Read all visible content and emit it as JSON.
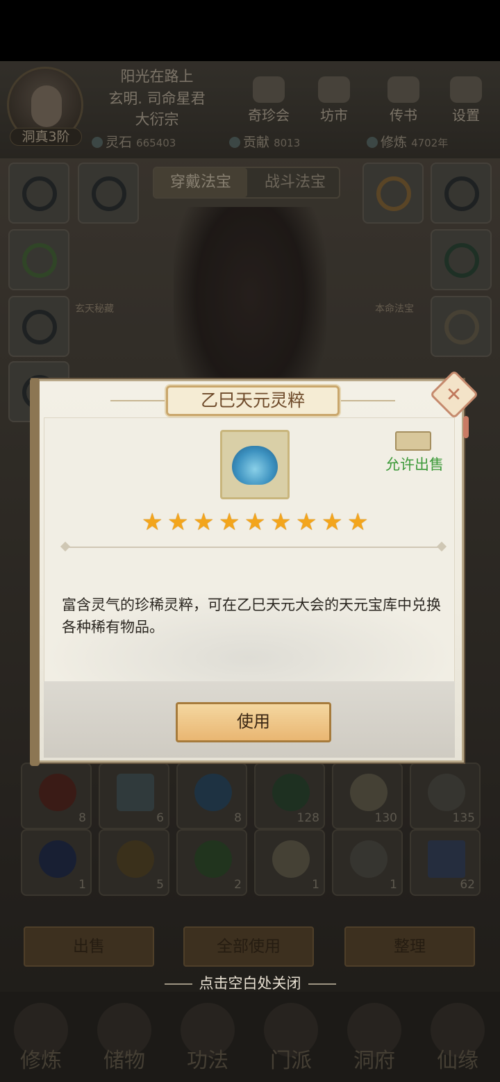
{
  "header": {
    "player_name": "阳光在路上",
    "title": "玄明. 司命星君",
    "sect": "大衍宗",
    "realm": "洞真3阶",
    "buttons": [
      "奇珍会",
      "坊市",
      "传书",
      "设置"
    ],
    "resources": [
      {
        "label": "灵石",
        "value": "665403"
      },
      {
        "label": "贡献",
        "value": "8013"
      },
      {
        "label": "修炼",
        "value": "4702年"
      }
    ]
  },
  "equipment": {
    "tabs": [
      "穿戴法宝",
      "战斗法宝"
    ],
    "labels": [
      "玄天秘藏",
      "本命法宝"
    ]
  },
  "inventory": {
    "row1_counts": [
      "8",
      "6",
      "8",
      "128",
      "130",
      "135"
    ],
    "row2_counts": [
      "1",
      "5",
      "2",
      "1",
      "1",
      "62"
    ],
    "actions": [
      "出售",
      "全部使用",
      "整理"
    ]
  },
  "bottom_nav": [
    "修炼",
    "储物",
    "功法",
    "门派",
    "洞府",
    "仙缘"
  ],
  "close_hint": "点击空白处关闭",
  "dialog": {
    "title": "乙巳天元灵粹",
    "sell_label": "允许出售",
    "stars": 9,
    "description": "富含灵气的珍稀灵粹，可在乙巳天元大会的天元宝库中兑换各种稀有物品。",
    "use_button": "使用",
    "close_icon": "close-icon"
  }
}
